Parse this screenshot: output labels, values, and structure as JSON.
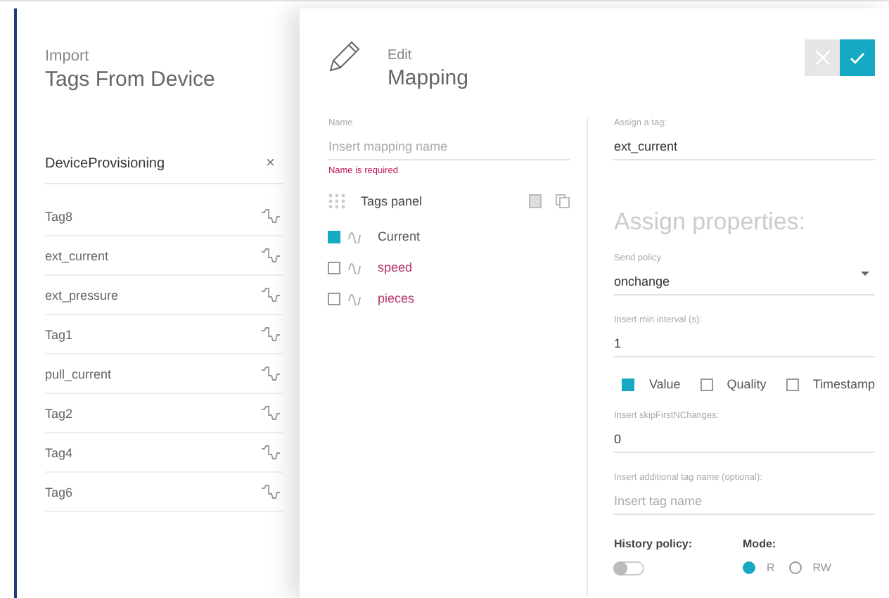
{
  "import_panel": {
    "overline": "Import",
    "title": "Tags From Device",
    "device": {
      "label": "DeviceProvisioning",
      "clear": "×"
    },
    "tags": [
      {
        "name": "Tag8"
      },
      {
        "name": "ext_current"
      },
      {
        "name": "ext_pressure"
      },
      {
        "name": "Tag1"
      },
      {
        "name": "pull_current"
      },
      {
        "name": "Tag2"
      },
      {
        "name": "Tag4"
      },
      {
        "name": "Tag6"
      }
    ]
  },
  "edit_panel": {
    "overline": "Edit",
    "title": "Mapping",
    "name_field": {
      "label": "Name",
      "placeholder": "Insert mapping name",
      "error": "Name is required"
    },
    "tags_panel": {
      "title": "Tags panel",
      "items": [
        {
          "name": "Current",
          "checked": true,
          "error": false
        },
        {
          "name": "speed",
          "checked": false,
          "error": true
        },
        {
          "name": "pieces",
          "checked": false,
          "error": true
        }
      ]
    },
    "assign_tag": {
      "label": "Assign a tag:",
      "value": "ext_current"
    },
    "properties_heading": "Assign properties:",
    "send_policy": {
      "label": "Send policy",
      "value": "onchange"
    },
    "min_interval": {
      "label": "Insert min interval (s):",
      "value": "1"
    },
    "options": [
      {
        "label": "Value",
        "checked": true
      },
      {
        "label": "Quality",
        "checked": false
      },
      {
        "label": "Timestamp",
        "checked": false
      }
    ],
    "skip_changes": {
      "label": "Insert skipFirstNChanges:",
      "value": "0"
    },
    "additional_name": {
      "label": "Insert additional tag name (optional):",
      "placeholder": "Insert tag name"
    },
    "history_policy": {
      "label": "History policy:",
      "on": false
    },
    "mode": {
      "label": "Mode:",
      "options": [
        {
          "label": "R",
          "selected": true
        },
        {
          "label": "RW",
          "selected": false
        }
      ]
    }
  }
}
